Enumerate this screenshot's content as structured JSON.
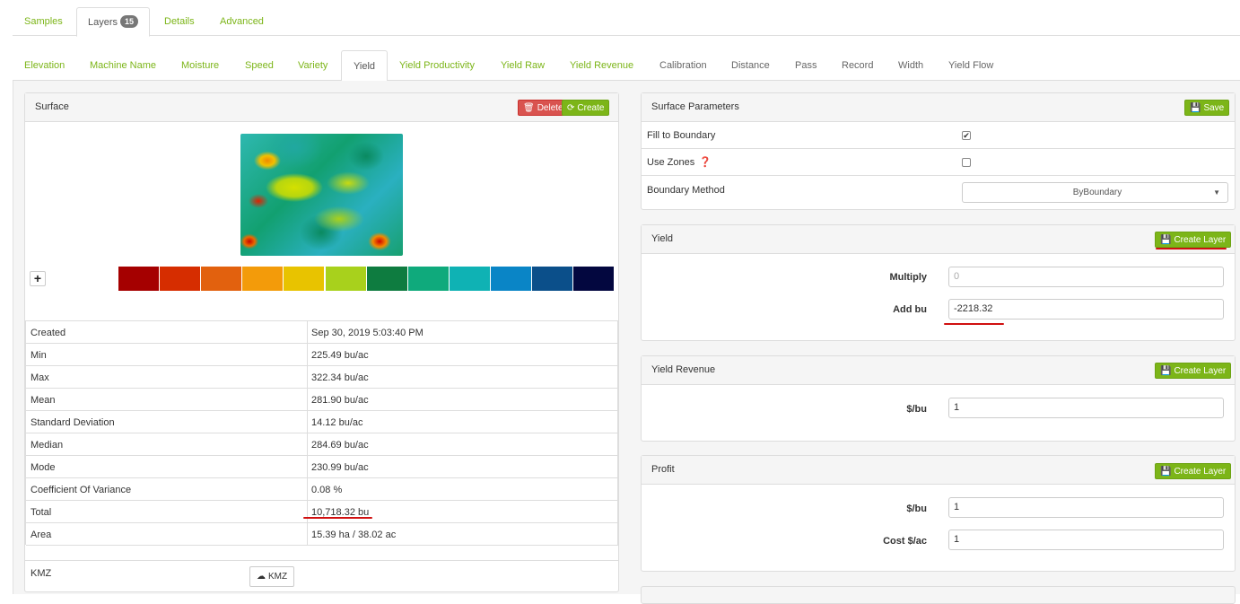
{
  "top_tabs": [
    {
      "label": "Samples"
    },
    {
      "label": "Layers",
      "badge": "15"
    },
    {
      "label": "Details"
    },
    {
      "label": "Advanced"
    }
  ],
  "sub_tabs": [
    {
      "label": "Elevation"
    },
    {
      "label": "Machine Name"
    },
    {
      "label": "Moisture"
    },
    {
      "label": "Speed"
    },
    {
      "label": "Variety"
    },
    {
      "label": "Yield"
    },
    {
      "label": "Yield Productivity"
    },
    {
      "label": "Yield Raw"
    },
    {
      "label": "Yield Revenue"
    },
    {
      "label": "Calibration"
    },
    {
      "label": "Distance"
    },
    {
      "label": "Pass"
    },
    {
      "label": "Record"
    },
    {
      "label": "Width"
    },
    {
      "label": "Yield Flow"
    }
  ],
  "surface": {
    "title": "Surface",
    "delete_label": "Delete",
    "create_label": "Create",
    "plus_label": "+",
    "legend_colors": [
      "#a50000",
      "#d62d00",
      "#e2610e",
      "#f39b0a",
      "#e8c300",
      "#a8d11c",
      "#0e7c40",
      "#0faa7c",
      "#0fb2b4",
      "#0a85c6",
      "#0b4f8a",
      "#03073f"
    ],
    "stats": [
      {
        "key": "Created",
        "value": "Sep 30, 2019 5:03:40 PM"
      },
      {
        "key": "Min",
        "value": "225.49 bu/ac"
      },
      {
        "key": "Max",
        "value": "322.34 bu/ac"
      },
      {
        "key": "Mean",
        "value": "281.90 bu/ac"
      },
      {
        "key": "Standard Deviation",
        "value": "14.12 bu/ac"
      },
      {
        "key": "Median",
        "value": "284.69 bu/ac"
      },
      {
        "key": "Mode",
        "value": "230.99 bu/ac"
      },
      {
        "key": "Coefficient Of Variance",
        "value": "0.08 %"
      },
      {
        "key": "Total",
        "value": "10,718.32 bu"
      },
      {
        "key": "Area",
        "value": "15.39 ha / 38.02 ac"
      }
    ],
    "kmz_label": "KMZ",
    "kmz_button": "KMZ"
  },
  "surface_params": {
    "title": "Surface Parameters",
    "save_label": "Save",
    "fill_to_boundary": {
      "label": "Fill to Boundary",
      "checked": true
    },
    "use_zones": {
      "label": "Use Zones",
      "checked": false
    },
    "boundary_method": {
      "label": "Boundary Method",
      "value": "ByBoundary"
    }
  },
  "yield_panel": {
    "title": "Yield",
    "create_label": "Create Layer",
    "multiply_label": "Multiply",
    "multiply_placeholder": "0",
    "add_label": "Add bu",
    "add_value": "-2218.32"
  },
  "yield_revenue_panel": {
    "title": "Yield Revenue",
    "create_label": "Create Layer",
    "per_bu_label": "$/bu",
    "per_bu_value": "1"
  },
  "profit_panel": {
    "title": "Profit",
    "create_label": "Create Layer",
    "per_bu_label": "$/bu",
    "per_bu_value": "1",
    "cost_label": "Cost $/ac",
    "cost_value": "1"
  }
}
